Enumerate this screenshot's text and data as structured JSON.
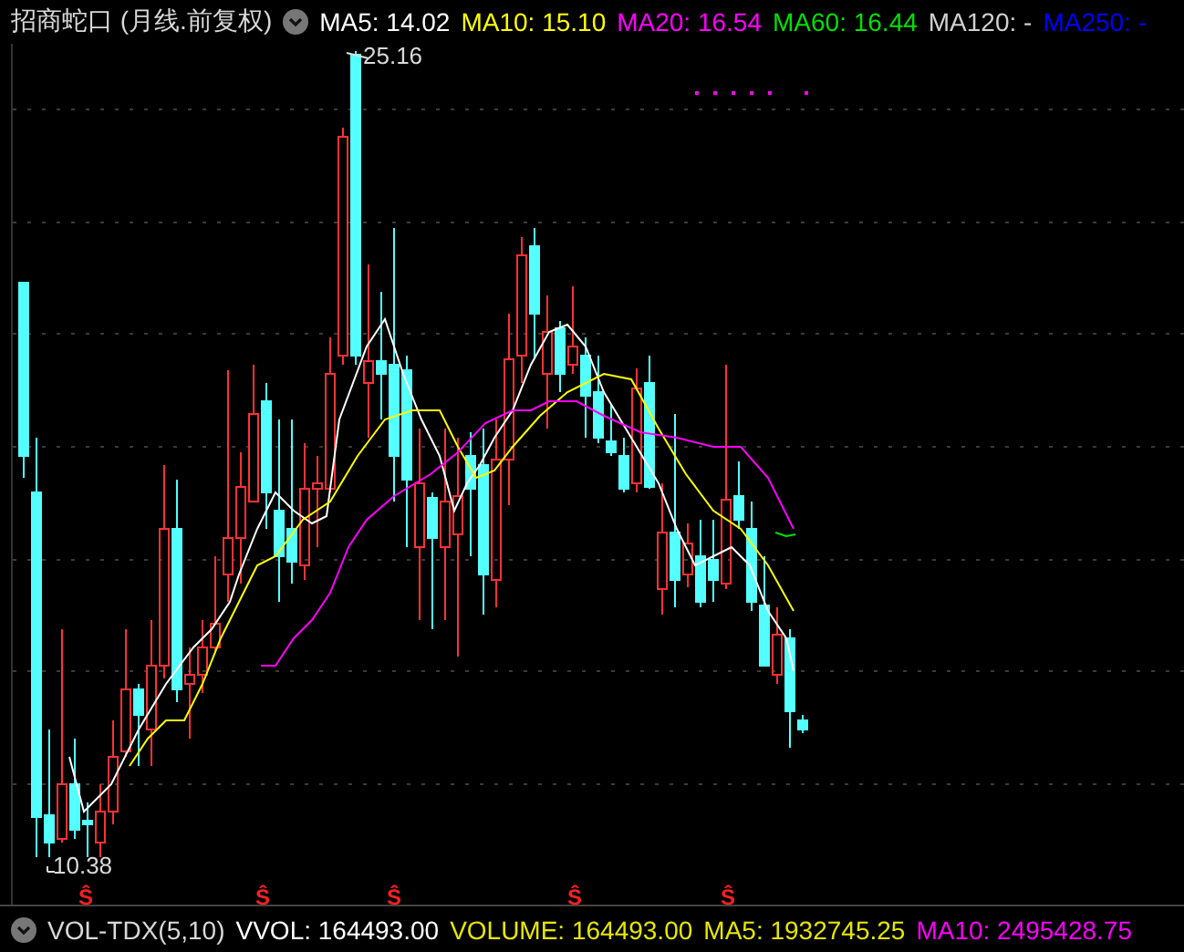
{
  "chart_title": "招商蛇口 (月线.前复权)",
  "ma_legend": [
    {
      "text": "MA5: 14.02",
      "color": "#ffffff"
    },
    {
      "text": "MA10: 15.10",
      "color": "#ffff00"
    },
    {
      "text": "MA20: 16.54",
      "color": "#ff00ff"
    },
    {
      "text": "MA60: 16.44",
      "color": "#00e000"
    },
    {
      "text": "MA120: -",
      "color": "#d0d0d0"
    },
    {
      "text": "MA250: -",
      "color": "#0000ff"
    }
  ],
  "high_label": "25.16",
  "low_label": "10.38",
  "signals": [
    {
      "label": "Ŝ"
    },
    {
      "label": "Ŝ"
    },
    {
      "label": "Ŝ"
    },
    {
      "label": "Ŝ"
    },
    {
      "label": "Ŝ"
    }
  ],
  "volume_panel": {
    "name": "VOL-TDX(5,10)",
    "items": [
      {
        "text": "VVOL: 164493.00",
        "color": "#ffffff"
      },
      {
        "text": "VOLUME: 164493.00",
        "color": "#e6e600"
      },
      {
        "text": "MA5: 1932745.25",
        "color": "#e6e600"
      },
      {
        "text": "MA10: 2495428.75",
        "color": "#ff00ff"
      }
    ]
  }
}
